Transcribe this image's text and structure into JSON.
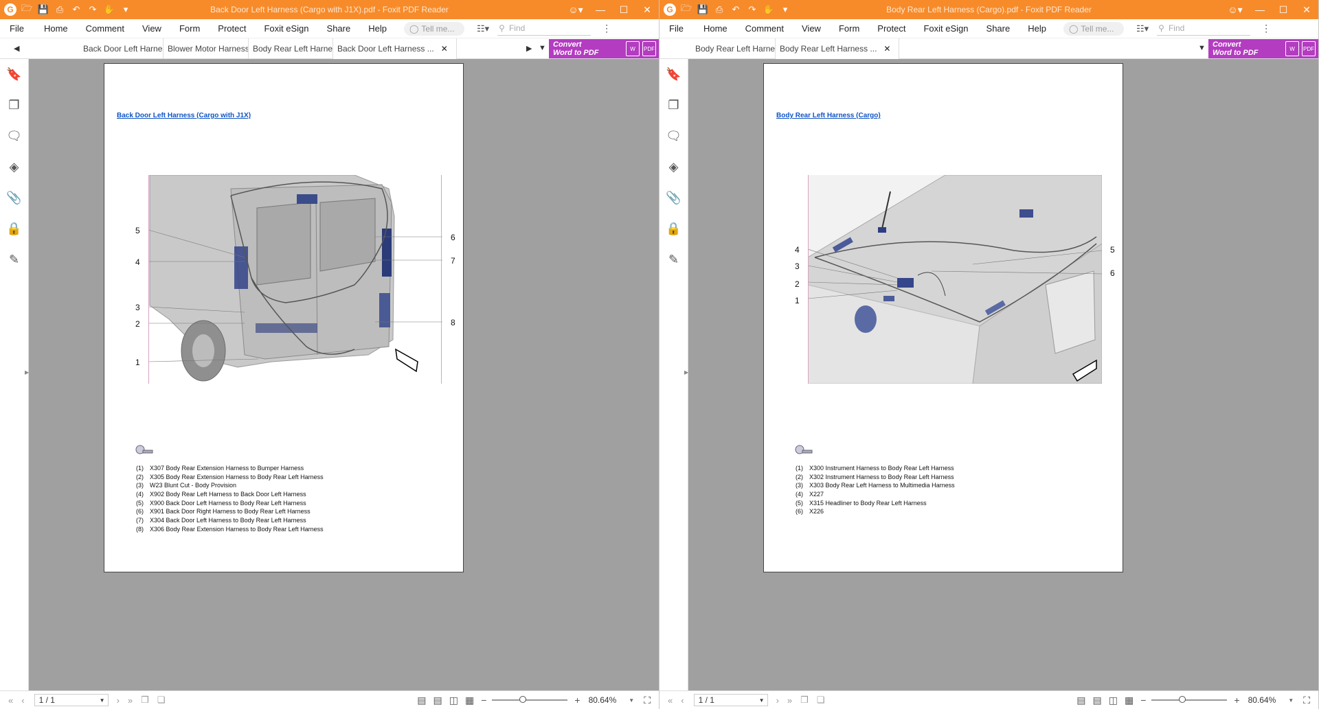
{
  "left": {
    "window_title": "Back Door Left Harness (Cargo with J1X).pdf - Foxit PDF Reader",
    "menu": [
      "File",
      "Home",
      "Comment",
      "View",
      "Form",
      "Protect",
      "Foxit eSign",
      "Share",
      "Help"
    ],
    "tell_me": "Tell me...",
    "find": "Find",
    "tabs": [
      "Back Door Left Harness...",
      "Blower Motor Harness....",
      "Body Rear Left Harness...",
      "Back Door Left Harness ..."
    ],
    "convert": {
      "line1": "Convert",
      "line2": "Word to PDF"
    },
    "doc_title": "Back Door Left Harness (Cargo with J1X)",
    "callouts": [
      "1",
      "2",
      "3",
      "4",
      "5",
      "6",
      "7",
      "8"
    ],
    "legend": [
      {
        "num": "(1)",
        "text": "X307 Body Rear Extension Harness to Bumper Harness"
      },
      {
        "num": "(2)",
        "text": "X305 Body Rear Extension Harness to Body Rear Left Harness"
      },
      {
        "num": "(3)",
        "text": "W23 Blunt Cut - Body Provision"
      },
      {
        "num": "(4)",
        "text": "X902 Body Rear Left Harness to Back Door Left Harness"
      },
      {
        "num": "(5)",
        "text": "X900 Back Door Left Harness to Body Rear Left Harness"
      },
      {
        "num": "(6)",
        "text": "X901 Back Door Right Harness to Body Rear Left Harness"
      },
      {
        "num": "(7)",
        "text": "X304 Back Door Left Harness to Body Rear Left Harness"
      },
      {
        "num": "(8)",
        "text": "X306 Body Rear Extension Harness to Body Rear Left Harness"
      }
    ],
    "page_indicator": "1 / 1",
    "zoom": "80.64%"
  },
  "right": {
    "window_title": "Body Rear Left Harness (Cargo).pdf - Foxit PDF Reader",
    "menu": [
      "File",
      "Home",
      "Comment",
      "View",
      "Form",
      "Protect",
      "Foxit eSign",
      "Share",
      "Help"
    ],
    "tell_me": "Tell me...",
    "find": "Find",
    "tabs": [
      "Body Rear Left Harness...",
      "Body Rear Left Harness ..."
    ],
    "convert": {
      "line1": "Convert",
      "line2": "Word to PDF"
    },
    "doc_title": "Body Rear Left Harness (Cargo)",
    "callouts": [
      "1",
      "2",
      "3",
      "4",
      "5",
      "6"
    ],
    "legend": [
      {
        "num": "(1)",
        "text": "X300 Instrument Harness to Body Rear Left Harness"
      },
      {
        "num": "(2)",
        "text": "X302 Instrument Harness to Body Rear Left Harness"
      },
      {
        "num": "(3)",
        "text": "X303 Body Rear Left Harness to Multimedia Harness"
      },
      {
        "num": "(4)",
        "text": "X227"
      },
      {
        "num": "(5)",
        "text": "X315 Headliner to Body Rear Left Harness"
      },
      {
        "num": "(6)",
        "text": "X226"
      }
    ],
    "page_indicator": "1 / 1",
    "zoom": "80.64%"
  },
  "colors": {
    "titlebar": "#f78b2a",
    "convert": "#b33cc0",
    "link": "#1055c4",
    "docbg": "#a0a0a0"
  }
}
